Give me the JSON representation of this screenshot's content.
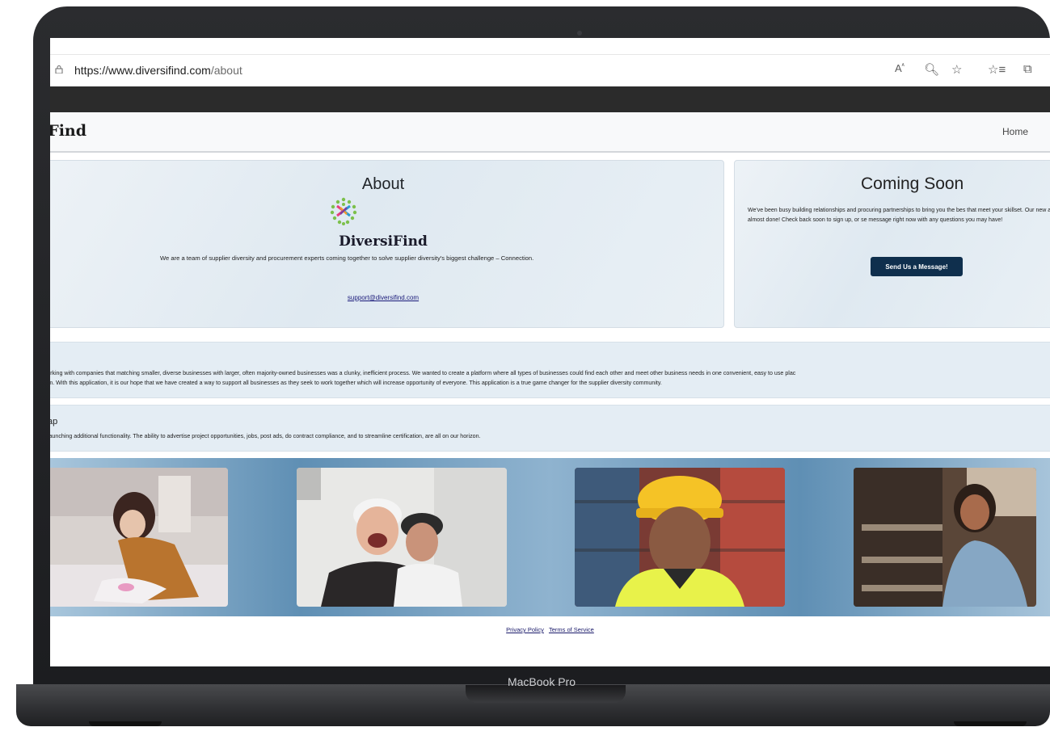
{
  "device": {
    "label": "MacBook Pro"
  },
  "browser": {
    "url_host": "https://www.diversifind.com",
    "url_path": "/about",
    "icons": [
      "lock-icon",
      "read-aloud-icon",
      "zoom-icon",
      "favorite-add-icon",
      "favorites-icon",
      "collections-icon"
    ]
  },
  "nav": {
    "brand": "iFind",
    "home": "Home"
  },
  "about": {
    "title": "About",
    "logo_text": "DiversiFind",
    "description": "We are a team of supplier diversity and procurement experts coming together to solve supplier diversity's biggest challenge – Connection.",
    "email": "support@diversifind.com"
  },
  "coming_soon": {
    "title": "Coming Soon",
    "text": "We've been busy building relationships and procuring partnerships to bring you the bes that meet your skillset. Our new app is almost done! Check back soon to sign up, or se message right now with any questions you may have!",
    "button": "Send Us a Message!"
  },
  "story": {
    "line1": "working with companies that matching smaller, diverse businesses with larger, often majority-owned businesses was a clunky, inefficient process. We wanted to create a platform where all types of businesses could find each other and meet other business needs in one convenient, easy to use plac",
    "line2": "orm. With this application, it is our hope that we have created a way to support all businesses as they seek to work together which will increase opportunity of everyone. This application is a true game changer for the supplier diversity community."
  },
  "roadmap": {
    "title": "ap",
    "text": "o launching additional functionality. The ability to advertise project opportunities, jobs, post ads, do contract compliance, and to streamline certification, are all on our horizon."
  },
  "footer": {
    "privacy": "Privacy Policy",
    "terms": "Terms of Service"
  },
  "colors": {
    "button_bg": "#0f2f4d",
    "dark_bar": "#2b2b2b",
    "link": "#1a1a6a"
  }
}
